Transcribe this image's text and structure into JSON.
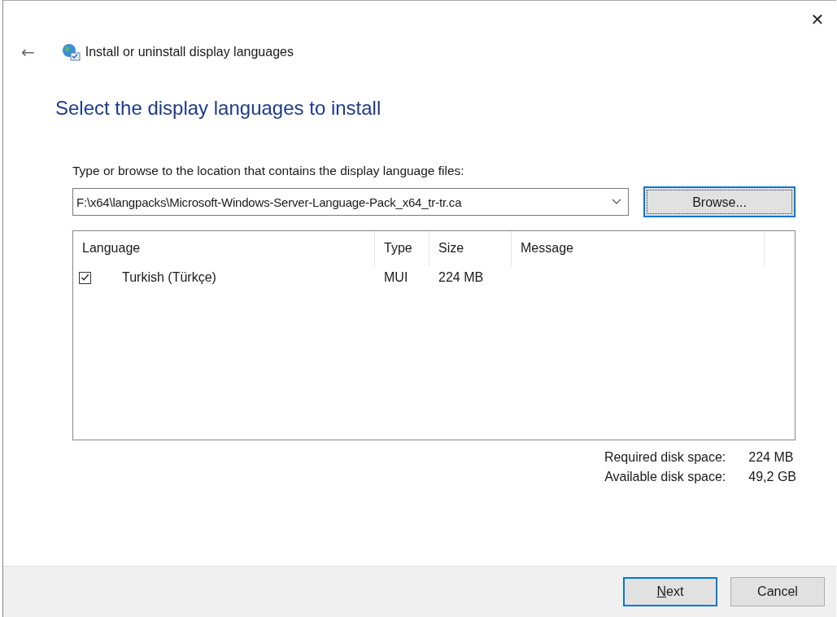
{
  "window": {
    "close": "✕"
  },
  "header": {
    "back": "←",
    "title": "Install or uninstall display languages"
  },
  "heading": "Select the display languages to install",
  "location": {
    "label": "Type or browse to the location that contains the display language files:",
    "value": "F:\\x64\\langpacks\\Microsoft-Windows-Server-Language-Pack_x64_tr-tr.ca",
    "browse": {
      "label": "Browse...",
      "highlighted": true
    }
  },
  "table": {
    "columns": [
      "Language",
      "Type",
      "Size",
      "Message"
    ],
    "rows": [
      {
        "checked": true,
        "language": "Turkish (Türkçe)",
        "type": "MUI",
        "size": "224 MB"
      }
    ]
  },
  "disk": [
    {
      "label": "Required disk space:",
      "value": "224 MB"
    },
    {
      "label": "Available disk space:",
      "value": "49,2 GB"
    }
  ],
  "buttons": [
    {
      "label": "Next",
      "mnemonic": true,
      "highlighted": true
    },
    {
      "label": "Cancel",
      "mnemonic": false,
      "highlighted": false
    }
  ]
}
